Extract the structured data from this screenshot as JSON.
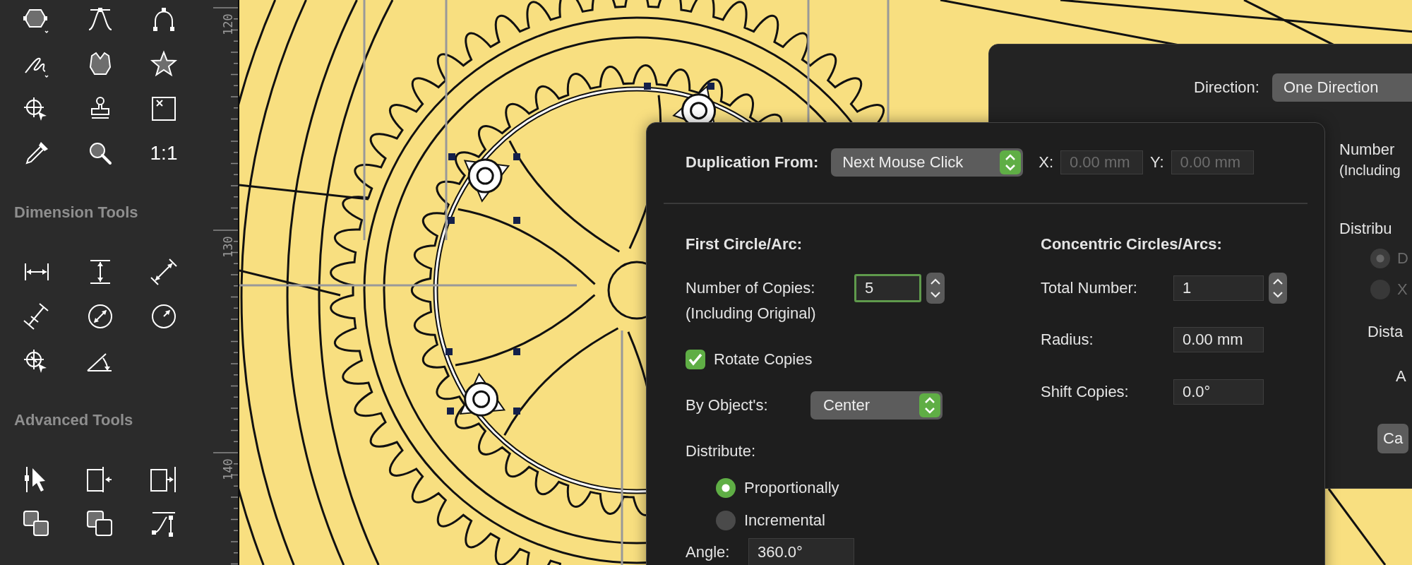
{
  "tool_palette": {
    "zoom_label": "1:1",
    "sections": [
      {
        "title": "Dimension Tools"
      },
      {
        "title": "Advanced Tools"
      }
    ]
  },
  "ruler": {
    "labels": [
      "120",
      "130",
      "140"
    ]
  },
  "back_dialog": {
    "direction_label": "Direction:",
    "direction_value": "One Direction",
    "number_label": "Number",
    "number_note": "(Including",
    "distribute_label": "Distribu",
    "options": [
      {
        "label": "D",
        "selected": true,
        "disabled": true
      },
      {
        "label": "X",
        "selected": false,
        "disabled": true
      }
    ],
    "distance_label": "Dista",
    "angle_label": "A",
    "cancel_button": "Ca"
  },
  "front_dialog": {
    "duplication_label": "Duplication From:",
    "duplication_value": "Next Mouse Click",
    "coords": [
      {
        "label": "X:",
        "placeholder": "0.00 mm"
      },
      {
        "label": "Y:",
        "placeholder": "0.00 mm"
      }
    ],
    "first": {
      "heading": "First Circle/Arc:",
      "copies_label": "Number of Copies:",
      "copies_note": "(Including Original)",
      "copies_value": "5",
      "copies_focused": true,
      "rotate": {
        "label": "Rotate Copies",
        "checked": true
      },
      "by_label": "By Object's:",
      "by_value": "Center",
      "distribute_label": "Distribute:",
      "distribute_options": [
        {
          "label": "Proportionally",
          "selected": true
        },
        {
          "label": "Incremental",
          "selected": false
        }
      ],
      "angle_label": "Angle:",
      "angle_value": "360.0°"
    },
    "concentric": {
      "heading": "Concentric Circles/Arcs:",
      "fields": [
        {
          "label": "Total Number:",
          "value": "1",
          "stepper": true
        },
        {
          "label": "Radius:",
          "value": "0.00 mm",
          "stepper": false
        },
        {
          "label": "Shift Copies:",
          "value": "0.0°",
          "stepper": false
        }
      ]
    }
  }
}
